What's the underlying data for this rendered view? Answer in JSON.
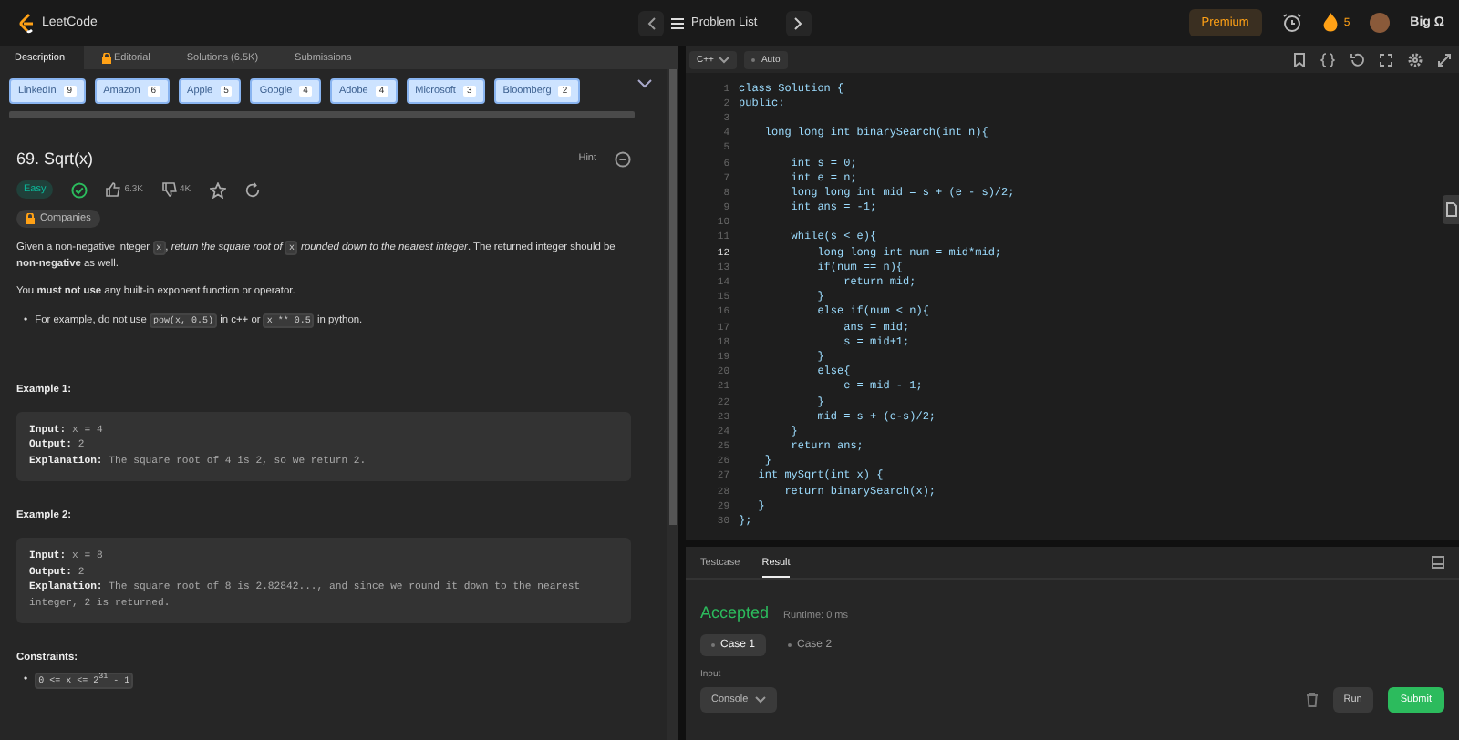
{
  "topbar": {
    "logo": "LeetCode",
    "problem_list": "Problem List",
    "premium": "Premium",
    "streak": "5",
    "user": "Big Ω"
  },
  "left_tabs": [
    {
      "label": "Description",
      "selected": true,
      "locked": false
    },
    {
      "label": "Editorial",
      "selected": false,
      "locked": true
    },
    {
      "label": "Solutions (6.5K)",
      "selected": false,
      "locked": false
    },
    {
      "label": "Submissions",
      "selected": false,
      "locked": false
    }
  ],
  "company_tags": [
    {
      "name": "LinkedIn",
      "count": "9"
    },
    {
      "name": "Amazon",
      "count": "6"
    },
    {
      "name": "Apple",
      "count": "5"
    },
    {
      "name": "Google",
      "count": "4"
    },
    {
      "name": "Adobe",
      "count": "4"
    },
    {
      "name": "Microsoft",
      "count": "3"
    },
    {
      "name": "Bloomberg",
      "count": "2"
    }
  ],
  "problem": {
    "title": "69. Sqrt(x)",
    "hint": "Hint",
    "difficulty": "Easy",
    "solved": true,
    "likes": "6.3K",
    "dislikes": "4K",
    "companies": "Companies",
    "paragraphs": [
      [
        {
          "kind": "text",
          "text": "Given a non-negative integer "
        },
        {
          "kind": "code",
          "text": "x"
        },
        {
          "kind": "text",
          "text": ", *return the square root of* "
        },
        {
          "kind": "code",
          "text": "x"
        },
        {
          "kind": "text",
          "text": " *rounded down to the nearest integer*. The returned integer should be **non-negative** as well."
        }
      ],
      [
        {
          "kind": "text",
          "text": "You **must not use** any built-in exponent function or operator."
        }
      ]
    ],
    "bullets": [
      {
        "marker": "•",
        "segments": [
          {
            "kind": "text",
            "text": "For example, do not use "
          },
          {
            "kind": "code",
            "text": "pow(x, 0.5)"
          },
          {
            "kind": "text",
            "text": " in c++ or "
          },
          {
            "kind": "code",
            "text": "x ** 0.5"
          },
          {
            "kind": "text",
            "text": " in python."
          }
        ]
      }
    ],
    "examples": [
      {
        "title": "Example 1:",
        "lines": [
          {
            "label": "Input:",
            "text": " x = 4"
          },
          {
            "label": "Output:",
            "text": " 2"
          },
          {
            "label": "Explanation:",
            "text": " The square root of 4 is 2, so we return 2."
          }
        ]
      },
      {
        "title": "Example 2:",
        "lines": [
          {
            "label": "Input:",
            "text": " x = 8"
          },
          {
            "label": "Output:",
            "text": " 2"
          },
          {
            "label": "Explanation:",
            "text": " The square root of 8 is 2.82842..., and since we round it down to the nearest integer, 2 is returned."
          }
        ]
      }
    ],
    "constraints_title": "Constraints:",
    "constraints": [
      {
        "marker": "•",
        "text": "0 <= x <= 2$^{31}$ - 1"
      }
    ]
  },
  "editor": {
    "language": "C++",
    "mode": "Auto",
    "lines": [
      {
        "number": "1",
        "text": "class Solution {",
        "current": false
      },
      {
        "number": "2",
        "text": "public:",
        "current": false
      },
      {
        "number": "3",
        "current": false
      },
      {
        "number": "4",
        "text": "    long long int binarySearch(int n){",
        "current": false
      },
      {
        "number": "5",
        "current": false
      },
      {
        "number": "6",
        "text": "        int s = 0;",
        "current": false
      },
      {
        "number": "7",
        "text": "        int e = n;",
        "current": false
      },
      {
        "number": "8",
        "text": "        long long int mid = s + (e - s)/2;",
        "current": false
      },
      {
        "number": "9",
        "text": "        int ans = -1;",
        "current": false
      },
      {
        "number": "10",
        "current": false
      },
      {
        "number": "11",
        "text": "        while(s < e){",
        "current": false
      },
      {
        "number": "12",
        "text": "            long long int num = mid*mid;",
        "current": true
      },
      {
        "number": "13",
        "text": "            if(num == n){",
        "current": false
      },
      {
        "number": "14",
        "text": "                return mid;",
        "current": false
      },
      {
        "number": "15",
        "text": "            }",
        "current": false
      },
      {
        "number": "16",
        "text": "            else if(num < n){",
        "current": false
      },
      {
        "number": "17",
        "text": "                ans = mid;",
        "current": false
      },
      {
        "number": "18",
        "text": "                s = mid+1;",
        "current": false
      },
      {
        "number": "19",
        "text": "            }",
        "current": false
      },
      {
        "number": "20",
        "text": "            else{",
        "current": false
      },
      {
        "number": "21",
        "text": "                e = mid - 1;",
        "current": false
      },
      {
        "number": "22",
        "text": "            }",
        "current": false
      },
      {
        "number": "23",
        "text": "            mid = s + (e-s)/2;",
        "current": false
      },
      {
        "number": "24",
        "text": "        }",
        "current": false
      },
      {
        "number": "25",
        "text": "        return ans;",
        "current": false
      },
      {
        "number": "26",
        "text": "    }",
        "current": false
      },
      {
        "number": "27",
        "text": "   int mySqrt(int x) {",
        "current": false
      },
      {
        "number": "28",
        "text": "       return binarySearch(x);",
        "current": false
      },
      {
        "number": "29",
        "text": "   }",
        "current": false
      },
      {
        "number": "30",
        "text": "};",
        "current": false
      }
    ]
  },
  "console": {
    "tabs": [
      {
        "label": "Testcase",
        "selected": false
      },
      {
        "label": "Result",
        "selected": true
      }
    ],
    "status": "Accepted",
    "runtime": "Runtime: 0 ms",
    "cases": [
      {
        "label": "Case 1",
        "selected": true
      },
      {
        "label": "Case 2",
        "selected": false
      }
    ],
    "input_label": "Input",
    "console_button": "Console",
    "run": "Run",
    "submit": "Submit"
  }
}
